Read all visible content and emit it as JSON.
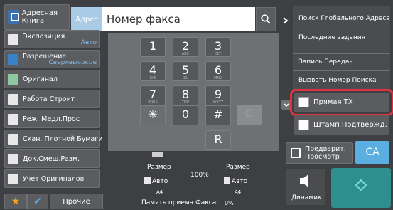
{
  "top": {
    "address_book": "Адресная Книга",
    "address_label": "Адрес",
    "fax_input_placeholder": "Номер факса"
  },
  "left_menu": [
    {
      "label": "Экспозиция",
      "value": "Авто"
    },
    {
      "label": "Разрешение",
      "value": "Сверхвысокое"
    },
    {
      "label": "Оригинал",
      "value": ""
    },
    {
      "label": "Работа Строит",
      "value": ""
    },
    {
      "label": "Реж. Медл.Прос",
      "value": ""
    },
    {
      "label": "Скан. Плотной Бумаги",
      "value": ""
    },
    {
      "label": "Док.Смеш.Разм.",
      "value": ""
    },
    {
      "label": "Учет Оригиналов",
      "value": ""
    }
  ],
  "bottom_left": {
    "others_label": "Прочие"
  },
  "keypad": {
    "keys": [
      {
        "n": "1",
        "s": ""
      },
      {
        "n": "2",
        "s": "ABC"
      },
      {
        "n": "3",
        "s": "DEF"
      },
      {
        "n": "4",
        "s": "GHI"
      },
      {
        "n": "5",
        "s": "JKL"
      },
      {
        "n": "6",
        "s": "MNO"
      },
      {
        "n": "7",
        "s": "PQRS"
      },
      {
        "n": "8",
        "s": "TUV"
      },
      {
        "n": "9",
        "s": "WXYZ"
      },
      {
        "n": "✳",
        "s": ""
      },
      {
        "n": "0",
        "s": ""
      },
      {
        "n": "#",
        "s": ""
      }
    ],
    "c_label": "C",
    "r_label": "R"
  },
  "size": {
    "size_label_left": "Размер",
    "size_value_left": "Авто",
    "paper_left": "A4",
    "zoom": "100%",
    "size_label_right": "Размер",
    "size_value_right": "Авто",
    "paper_right": "A4",
    "memory_label": "Память приема Факса:",
    "memory_value": "0%"
  },
  "right_menu": [
    "Поиск Глобального Адреса",
    "Последние задания",
    "Запись Передач",
    "Вызвать Номер Поиска"
  ],
  "checks": {
    "direct_tx": "Прямая TX",
    "stamp": "Штамп Подтвержд."
  },
  "actions": {
    "preview": "Предварит. Просмотр",
    "ca": "CA",
    "speaker": "Динамик"
  },
  "colors": {
    "accent": "#5aaee0",
    "highlight": "#e0303f",
    "start": "#2f8f8f"
  }
}
